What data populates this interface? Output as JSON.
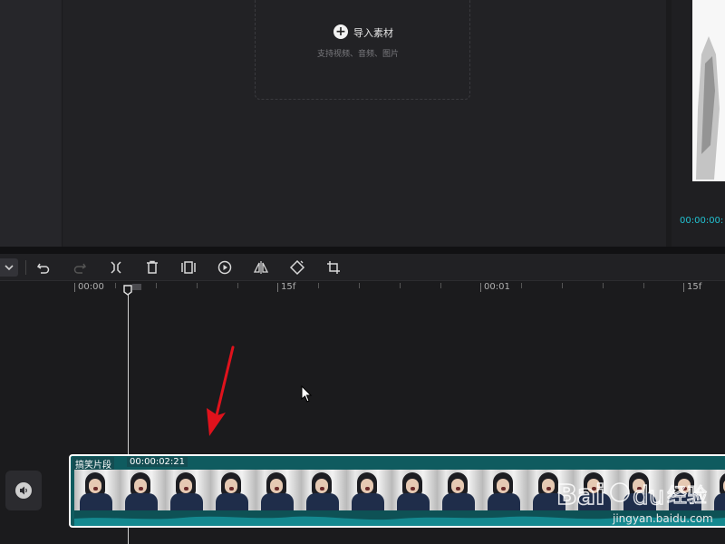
{
  "media": {
    "import_label": "导入素材",
    "import_hint": "支持视频、音频、图片",
    "plus_icon": "plus-icon"
  },
  "preview": {
    "timecode": "00:00:00:"
  },
  "toolbar": {
    "icons": [
      "chevron-down-icon",
      "undo-icon",
      "redo-icon",
      "split-icon",
      "delete-icon",
      "freeze-frame-icon",
      "play-circle-icon",
      "mirror-icon",
      "rotate-icon",
      "crop-icon"
    ]
  },
  "ruler": {
    "labels": [
      "00:00",
      "15f",
      "00:01",
      "15f"
    ]
  },
  "clip": {
    "name": "搞笑片段",
    "duration": "00:00:02:21",
    "frame_count": 15
  },
  "watermark": {
    "brand": "Baidu经验",
    "url": "jingyan.baidu.com"
  },
  "colors": {
    "accent": "#22c0d0",
    "clip_bg": "#0f5b5f",
    "arrow": "#e0121c"
  }
}
